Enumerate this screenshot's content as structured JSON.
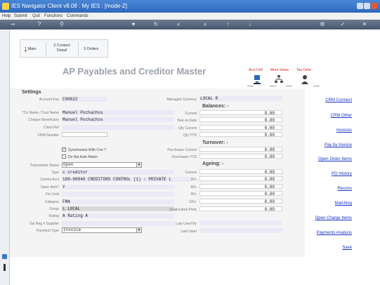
{
  "window": {
    "title": "IES Navigator Client v8.08 : My IES :     [mode-Z]"
  },
  "menu": [
    "Help",
    "Submit",
    "Quit",
    "Functions",
    "Commands"
  ],
  "tabs": [
    {
      "num": "1",
      "label": "Main"
    },
    {
      "num": "2",
      "label": "Contact Detail",
      "l1": "2 Contact",
      "l2": "Detail"
    },
    {
      "num": "3",
      "label": "Orders",
      "text": "3 Orders"
    }
  ],
  "page_title": "AP Payables and Creditor Master",
  "header_actions": {
    "drill": "Acct Drill",
    "more": "More Views",
    "tax": "Tax Certs"
  },
  "settings": {
    "heading": "Settings",
    "account_key_label": "Account Key",
    "account_key": "C00022",
    "name_label": "*Co Name / Cust Name",
    "name": "Manuel Pochachos",
    "cheque_label": "Cheque Beneficiary",
    "cheque": "Manuel Pochachos",
    "client_ref_label": "Client Ref",
    "client_ref": "",
    "crm_number_label": "CRM Number",
    "crm_number": "",
    "sync_crm_label": "Synchronize With Crm ?",
    "sync_crm": "✓",
    "no_auto_match_label": "Do Not Auto Match",
    "no_auto_match": "",
    "trans_status_label": "Transaction Status",
    "trans_status": "Open",
    "type_label": "Type",
    "type": "c creditor",
    "control_acct_label": "Control Acct",
    "control_acct": "100-00040 CREDITORS CONTROL (1) : PRIVATE L",
    "open_item_label": "Open Item?",
    "open_item": "Y",
    "fin_limit_label": "Fin Limit",
    "fin_limit": "",
    "category_label": "Category",
    "category": "FMA",
    "group_label": "Group",
    "group": "L LOCAL",
    "rating_label": "Rating",
    "rating": "A Rating A",
    "tax_reg_label": "Tax Reg # Supplier",
    "tax_reg": "",
    "payment_type_label": "Payment Type",
    "payment_type": "Invoice"
  },
  "right_col": {
    "managed_currency_label": "Managed Currency",
    "managed_currency": "LOCAL R",
    "balances_heading": "Balances: -",
    "current_label": "Current",
    "current": "0.00",
    "ytd_label": "Year-to-Date",
    "ytd": "0.00",
    "qty_current_label": "Qty Current",
    "qty_current": "0.00",
    "qty_ytd_label": "Qty YTD",
    "qty_ytd": "0.00",
    "turnover_heading": "Turnover: -",
    "purch_current_label": "Purchases Current",
    "purch_current": "0.00",
    "purch_ytd_label": "Purchases YTD",
    "purch_ytd": "0.00",
    "ageing_heading": "Ageing: -",
    "age_current_label": "Current",
    "age_current": "0.00",
    "age30_label": "30+",
    "age30": "0.00",
    "age60_label": "60+",
    "age60": "0.00",
    "age90_label": "90+",
    "age90": "0.00",
    "age120_label": "120+",
    "age120": "0.00",
    "unalloc_label": "Unallocated Pmts",
    "unalloc": "0.00",
    "last_used_by_label": "Last Used By",
    "last_used_by": "",
    "last_used_label": "Last Used",
    "last_used": ""
  },
  "links": [
    "CRM Connect",
    "CRM Other",
    "Invoices",
    "Pay by Invoice",
    "Open Order Items",
    "PO History",
    "Recons",
    "Matching",
    "Open Charge Items",
    "Payments Analysis",
    "Save"
  ],
  "colors": {
    "titlebar": "#3b78c9",
    "link": "#1833c9",
    "header_red": "#dd2222"
  }
}
